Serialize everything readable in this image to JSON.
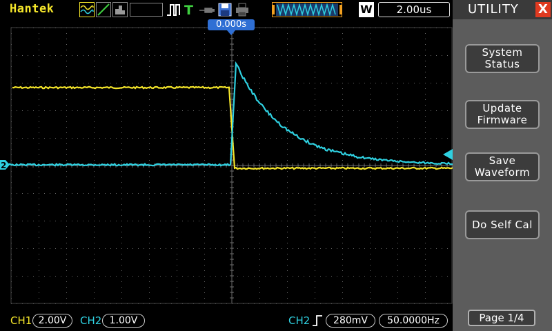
{
  "brand": "Hantek",
  "timebase": "2.00us",
  "timebase_mode_letter": "W",
  "trigger_position": "0.000s",
  "channel2_marker": "2",
  "bottom": {
    "ch1_label": "CH1",
    "ch1_scale": "2.00V",
    "ch2_label": "CH2",
    "ch2_scale": "1.00V",
    "trigger_source": "CH2",
    "trigger_level": "280mV",
    "frequency": "50.0000Hz"
  },
  "menu": {
    "title": "UTILITY",
    "close_glyph": "X",
    "buttons": [
      "System\nStatus",
      "Update\nFirmware",
      "Save\nWaveform",
      "Do Self Cal"
    ],
    "page": "Page 1/4"
  },
  "colors": {
    "ch1": "#f5e62a",
    "ch2": "#2fd0e0",
    "grid": "#6a6a6a",
    "menu_bg": "#5c5c5c"
  },
  "icons": [
    "scope-mode-icon",
    "ramp-icon",
    "acquire-icon",
    "pulse-trigger-icon",
    "trigger-icon",
    "probe-icon",
    "save-icon",
    "print-icon",
    "memory-waveform-icon"
  ]
}
